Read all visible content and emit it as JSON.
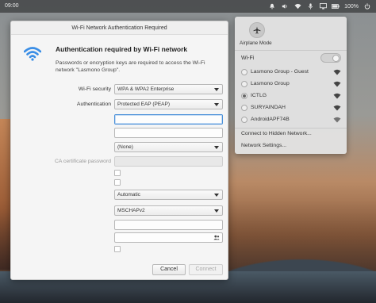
{
  "top_panel": {
    "clock": "09:00",
    "battery": "100%"
  },
  "dialog": {
    "title": "Wi-Fi Network Authentication Required",
    "heading": "Authentication required by Wi-Fi network",
    "description": "Passwords or encryption keys are required to access the Wi-Fi network \"Lasmono Group\".",
    "wifi_security_label": "Wi-Fi security",
    "wifi_security_value": "WPA & WPA2 Enterprise",
    "authentication_label": "Authentication",
    "authentication_value": "Protected EAP (PEAP)",
    "anonymous_identity_value": "",
    "domain_value": "",
    "ca_certificate_value": "(None)",
    "ca_certificate_password_label": "CA certificate password",
    "peap_version_value": "Automatic",
    "inner_auth_value": "MSCHAPv2",
    "username_value": "",
    "password_value": "",
    "cancel_label": "Cancel",
    "connect_label": "Connect"
  },
  "network_menu": {
    "airplane_mode_label": "Airplane Mode",
    "wifi_label": "Wi-Fi",
    "wifi_enabled": true,
    "networks": [
      {
        "name": "Lasmono Group - Guest",
        "selected": false
      },
      {
        "name": "Lasmono Group",
        "selected": false
      },
      {
        "name": "ICTLG",
        "selected": true
      },
      {
        "name": "SURYAINDAH",
        "selected": false
      },
      {
        "name": "AndroidAPF74B",
        "selected": false
      }
    ],
    "connect_hidden_label": "Connect to Hidden Network...",
    "network_settings_label": "Network Settings..."
  },
  "colors": {
    "accent": "#4a90d9",
    "wifi_icon": "#3a8ee6"
  }
}
